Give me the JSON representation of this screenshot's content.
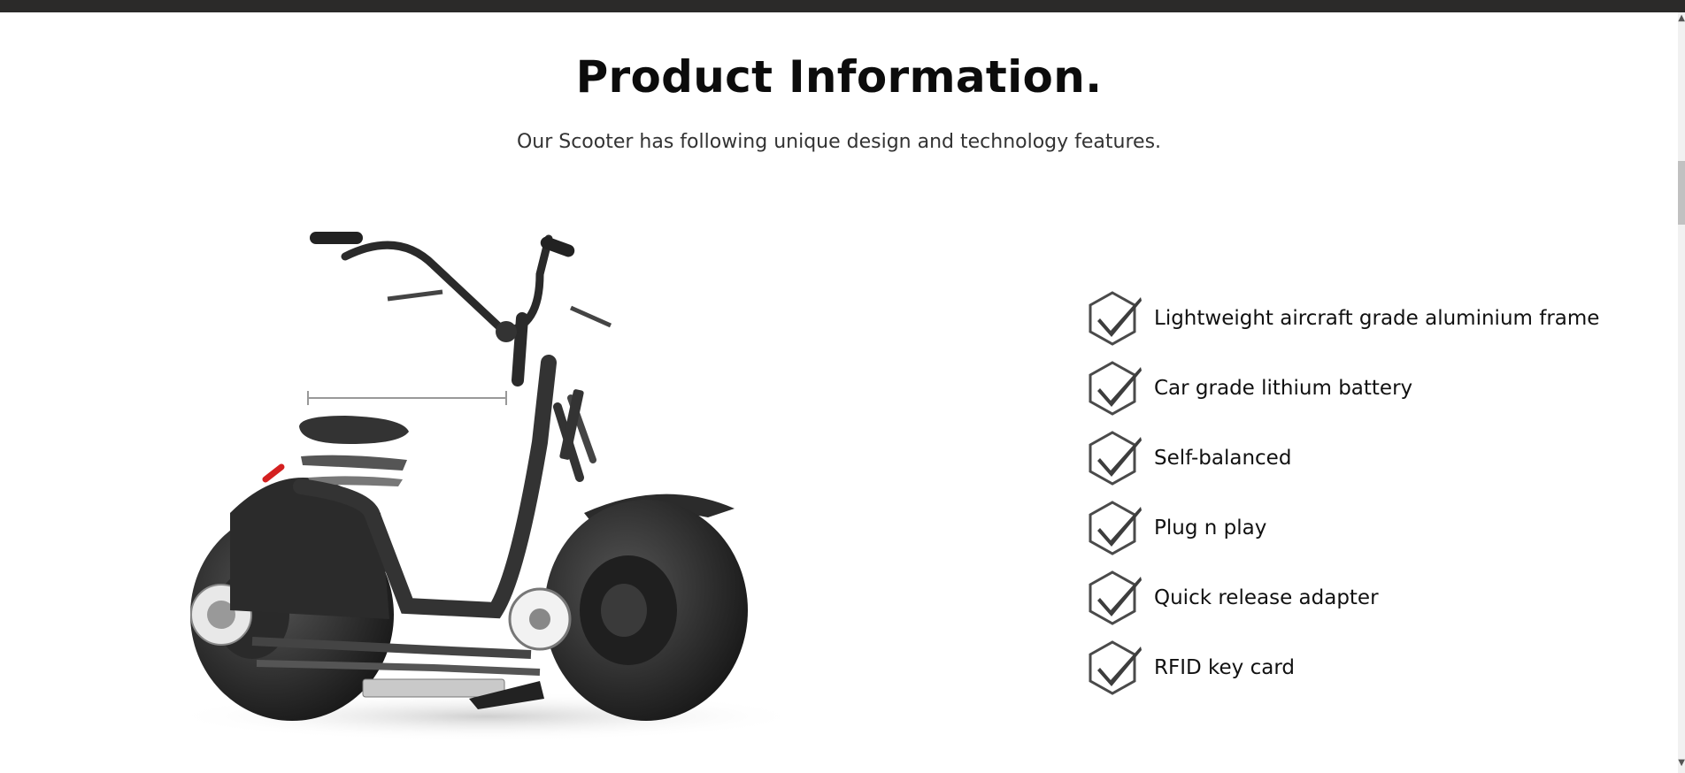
{
  "header": {
    "title": "Product Information.",
    "subtitle": "Our Scooter has following unique design and technology features."
  },
  "product_image": {
    "icon": "electric-scooter-exploded-illustration"
  },
  "features": {
    "icon": "hexagon-check-icon",
    "items": [
      {
        "label": "Lightweight aircraft grade aluminium frame"
      },
      {
        "label": "Car grade lithium battery"
      },
      {
        "label": "Self-balanced"
      },
      {
        "label": "Plug n play"
      },
      {
        "label": "Quick release adapter"
      },
      {
        "label": "RFID key card"
      }
    ]
  },
  "colors": {
    "topbar": "#2b2a29",
    "accent_red": "#d42020",
    "check_gray": "#4a4a4a"
  }
}
